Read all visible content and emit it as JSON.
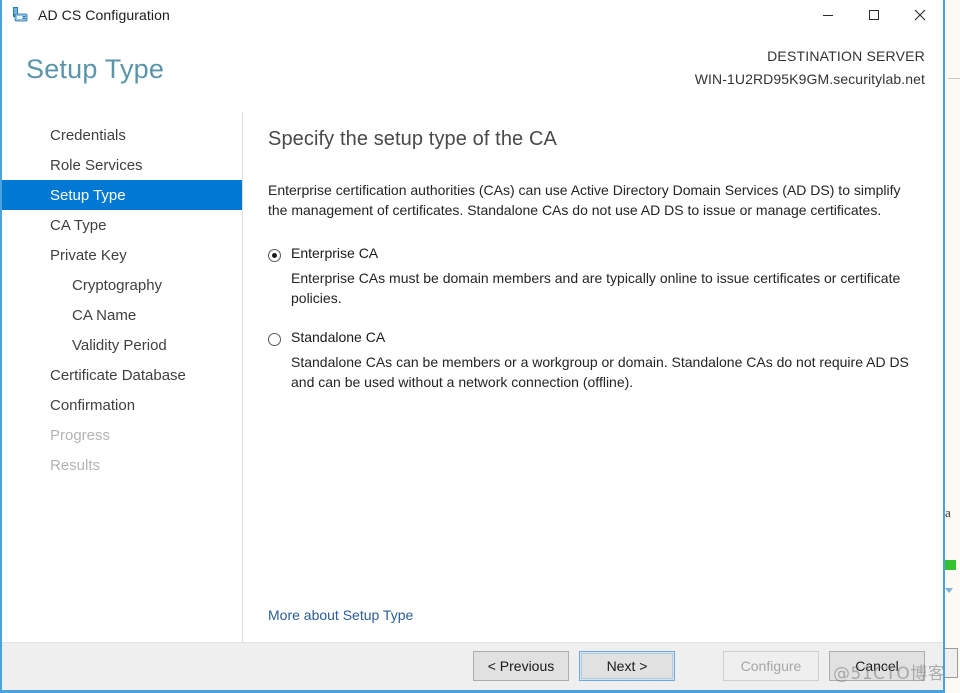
{
  "window": {
    "title": "AD CS Configuration",
    "icon": "adcs-configuration-icon",
    "controls": {
      "minimize": "minimize-icon",
      "maximize": "maximize-icon",
      "close": "close-icon"
    }
  },
  "header": {
    "page_title": "Setup Type",
    "destination_label": "DESTINATION SERVER",
    "destination_server": "WIN-1U2RD95K9GM.securitylab.net",
    "title_color": "#5a95aa"
  },
  "sidebar": {
    "items": [
      {
        "label": "Credentials",
        "state": "normal",
        "indent": false
      },
      {
        "label": "Role Services",
        "state": "normal",
        "indent": false
      },
      {
        "label": "Setup Type",
        "state": "selected",
        "indent": false
      },
      {
        "label": "CA Type",
        "state": "normal",
        "indent": false
      },
      {
        "label": "Private Key",
        "state": "normal",
        "indent": false
      },
      {
        "label": "Cryptography",
        "state": "normal",
        "indent": true
      },
      {
        "label": "CA Name",
        "state": "normal",
        "indent": true
      },
      {
        "label": "Validity Period",
        "state": "normal",
        "indent": true
      },
      {
        "label": "Certificate Database",
        "state": "normal",
        "indent": false
      },
      {
        "label": "Confirmation",
        "state": "normal",
        "indent": false
      },
      {
        "label": "Progress",
        "state": "disabled",
        "indent": false
      },
      {
        "label": "Results",
        "state": "disabled",
        "indent": false
      }
    ],
    "selected_color": "#0078d4"
  },
  "content": {
    "heading": "Specify the setup type of the CA",
    "description": "Enterprise certification authorities (CAs) can use Active Directory Domain Services (AD DS) to simplify the management of certificates. Standalone CAs do not use AD DS to issue or manage certificates.",
    "options": [
      {
        "label": "Enterprise CA",
        "selected": true,
        "description": "Enterprise CAs must be domain members and are typically online to issue certificates or certificate policies."
      },
      {
        "label": "Standalone CA",
        "selected": false,
        "description": "Standalone CAs can be members or a workgroup or domain. Standalone CAs do not require AD DS and can be used without a network connection (offline)."
      }
    ],
    "more_link": "More about Setup Type",
    "link_color": "#2a5d96"
  },
  "footer": {
    "buttons": [
      {
        "label": "< Previous",
        "state": "normal"
      },
      {
        "label": "Next >",
        "state": "focused"
      },
      {
        "label": "Configure",
        "state": "disabled"
      },
      {
        "label": "Cancel",
        "state": "normal"
      }
    ]
  },
  "watermark": {
    "text": "@51CTO博客"
  },
  "background": {
    "char": "a"
  }
}
